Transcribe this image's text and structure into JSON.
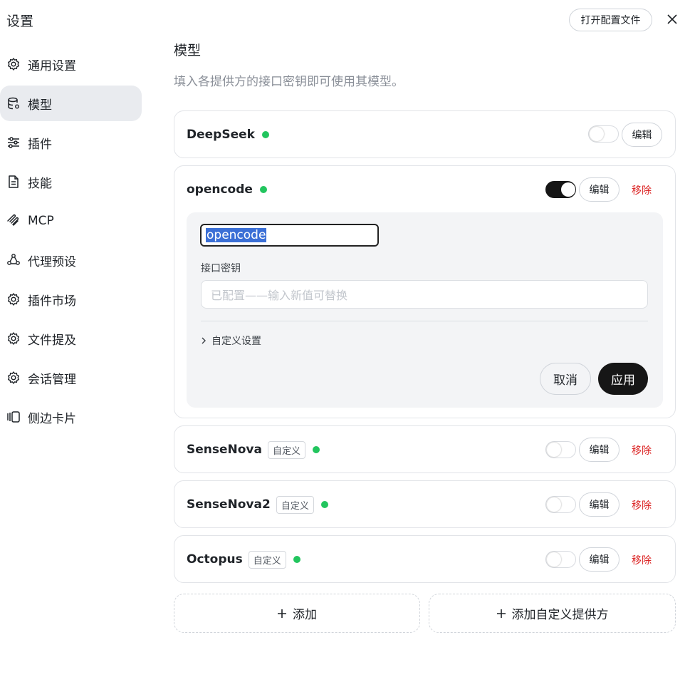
{
  "header": {
    "title": "设置",
    "open_config_label": "打开配置文件"
  },
  "sidebar": {
    "items": [
      {
        "label": "通用设置",
        "icon": "gear-icon",
        "active": false
      },
      {
        "label": "模型",
        "icon": "database-icon",
        "active": true
      },
      {
        "label": "插件",
        "icon": "sliders-icon",
        "active": false
      },
      {
        "label": "技能",
        "icon": "document-icon",
        "active": false
      },
      {
        "label": "MCP",
        "icon": "mcp-icon",
        "active": false
      },
      {
        "label": "代理预设",
        "icon": "agent-icon",
        "active": false
      },
      {
        "label": "插件市场",
        "icon": "gear-icon",
        "active": false
      },
      {
        "label": "文件提及",
        "icon": "gear-icon",
        "active": false
      },
      {
        "label": "会话管理",
        "icon": "gear-icon",
        "active": false
      },
      {
        "label": "侧边卡片",
        "icon": "side-panel-icon",
        "active": false
      }
    ]
  },
  "main": {
    "title": "模型",
    "description": "填入各提供方的接口密钥即可使用其模型。",
    "providers": [
      {
        "name": "DeepSeek",
        "tag": "",
        "status_color": "#22c55e",
        "enabled": false,
        "edit_label": "编辑",
        "remove_label": ""
      },
      {
        "name": "opencode",
        "tag": "",
        "status_color": "#22c55e",
        "enabled": true,
        "edit_label": "编辑",
        "remove_label": "移除"
      },
      {
        "name": "SenseNova",
        "tag": "自定义",
        "status_color": "#22c55e",
        "enabled": false,
        "edit_label": "编辑",
        "remove_label": "移除"
      },
      {
        "name": "SenseNova2",
        "tag": "自定义",
        "status_color": "#22c55e",
        "enabled": false,
        "edit_label": "编辑",
        "remove_label": "移除"
      },
      {
        "name": "Octopus",
        "tag": "自定义",
        "status_color": "#22c55e",
        "enabled": false,
        "edit_label": "编辑",
        "remove_label": "移除"
      }
    ],
    "edit_form": {
      "name_value": "opencode",
      "key_label": "接口密钥",
      "key_placeholder": "已配置——输入新值可替换",
      "custom_settings_label": "自定义设置",
      "cancel_label": "取消",
      "apply_label": "应用"
    },
    "add_label": "添加",
    "add_custom_label": "添加自定义提供方"
  },
  "colors": {
    "accent_dark": "#161616",
    "status_ok": "#22c55e",
    "danger": "#dc2626",
    "active_nav": "#e9ebef"
  }
}
